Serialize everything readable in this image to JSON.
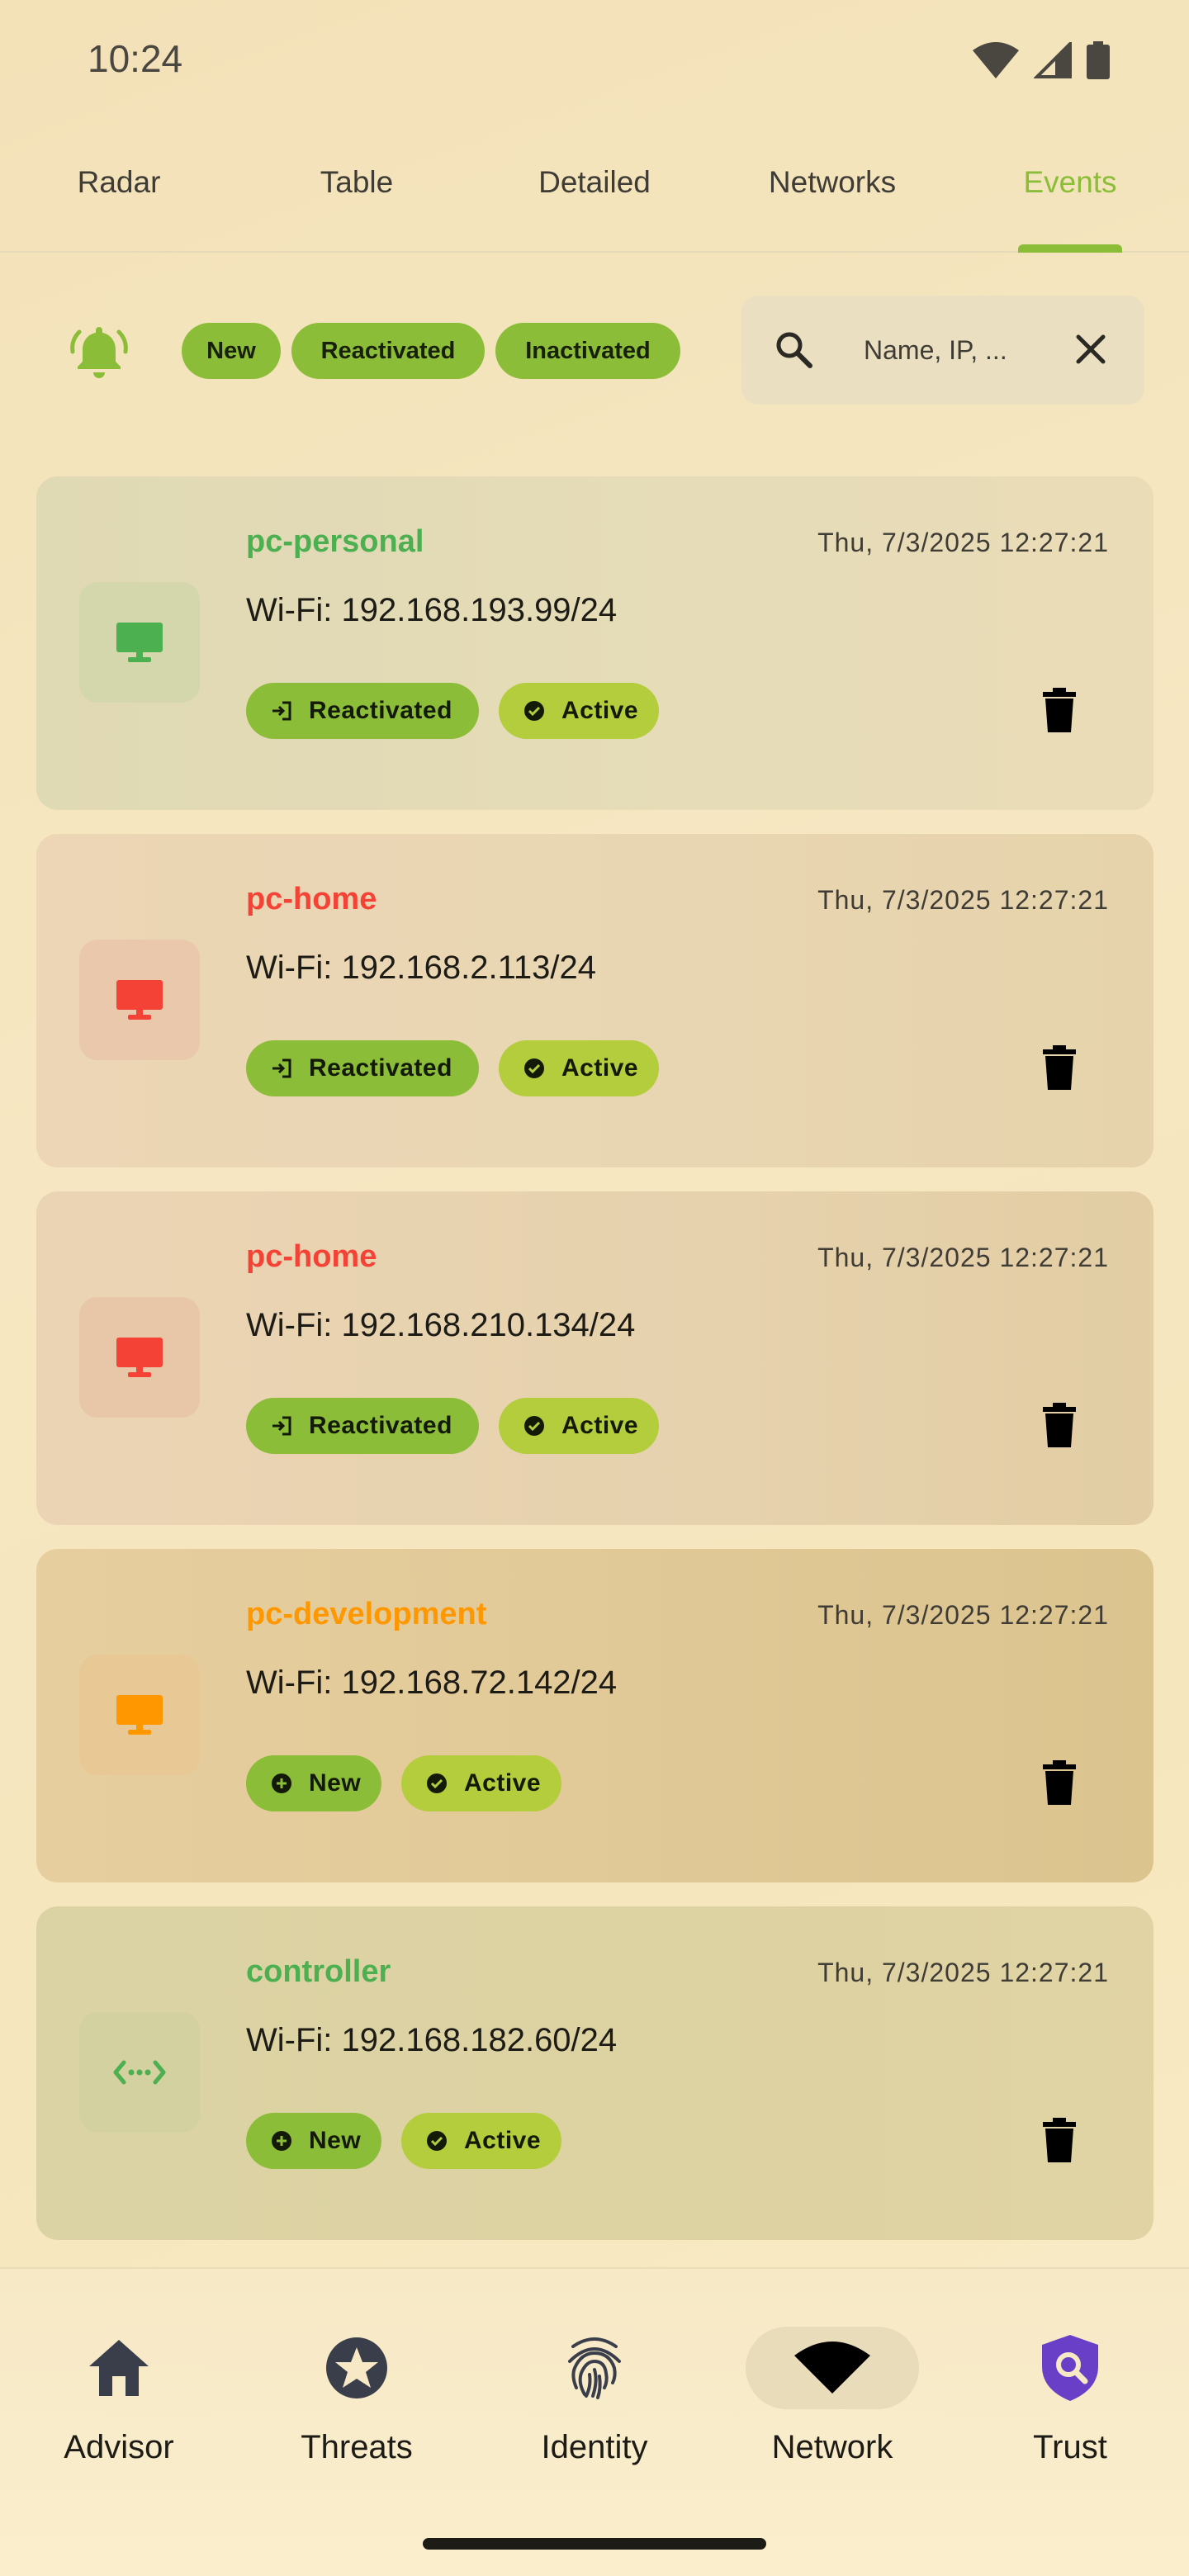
{
  "status_bar": {
    "time": "10:24"
  },
  "tabs": [
    {
      "label": "Radar"
    },
    {
      "label": "Table"
    },
    {
      "label": "Detailed"
    },
    {
      "label": "Networks"
    },
    {
      "label": "Events",
      "active": true
    }
  ],
  "filters": {
    "chips": [
      "New",
      "Reactivated",
      "Inactivated"
    ],
    "search_placeholder": "Name, IP, ..."
  },
  "events": [
    {
      "name": "pc-personal",
      "timestamp": "Thu, 7/3/2025 12:27:21",
      "network": "Wi-Fi: 192.168.193.99/24",
      "event_type": "Reactivated",
      "status": "Active",
      "device_icon": "monitor-icon",
      "color": "#4caf50"
    },
    {
      "name": "pc-home",
      "timestamp": "Thu, 7/3/2025 12:27:21",
      "network": "Wi-Fi: 192.168.2.113/24",
      "event_type": "Reactivated",
      "status": "Active",
      "device_icon": "monitor-icon",
      "color": "#f44336"
    },
    {
      "name": "pc-home",
      "timestamp": "Thu, 7/3/2025 12:27:21",
      "network": "Wi-Fi: 192.168.210.134/24",
      "event_type": "Reactivated",
      "status": "Active",
      "device_icon": "monitor-icon",
      "color": "#f44336"
    },
    {
      "name": "pc-development",
      "timestamp": "Thu, 7/3/2025 12:27:21",
      "network": "Wi-Fi: 192.168.72.142/24",
      "event_type": "New",
      "status": "Active",
      "device_icon": "monitor-icon",
      "color": "#ff9800"
    },
    {
      "name": "controller",
      "timestamp": "Thu, 7/3/2025 12:27:21",
      "network": "Wi-Fi: 192.168.182.60/24",
      "event_type": "New",
      "status": "Active",
      "device_icon": "settings-ethernet-icon",
      "color": "#4caf50"
    }
  ],
  "bottom_nav": [
    {
      "label": "Advisor",
      "icon": "home-icon"
    },
    {
      "label": "Threats",
      "icon": "star-badge-icon"
    },
    {
      "label": "Identity",
      "icon": "fingerprint-icon"
    },
    {
      "label": "Network",
      "icon": "wifi-icon",
      "active": true
    },
    {
      "label": "Trust",
      "icon": "shield-search-icon"
    }
  ],
  "colors": {
    "accent": "#8bbd38",
    "chip": "#8cbd39",
    "active_badge": "#b3cd3c",
    "trust_purple": "#6a3fc8"
  }
}
